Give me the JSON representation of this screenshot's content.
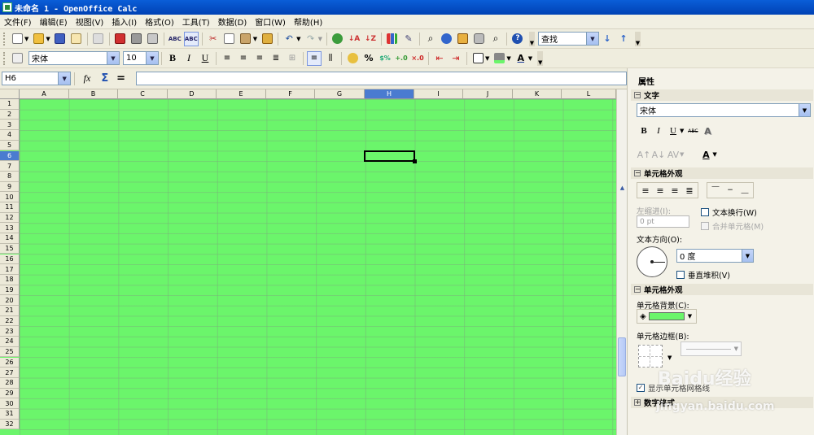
{
  "window": {
    "title": "未命名 1 - OpenOffice Calc"
  },
  "menu": [
    "文件(F)",
    "编辑(E)",
    "视图(V)",
    "插入(I)",
    "格式(O)",
    "工具(T)",
    "数据(D)",
    "窗口(W)",
    "帮助(H)"
  ],
  "toolbar": {
    "find_placeholder": "查找",
    "font_name": "宋体",
    "font_size": "10",
    "bold": "B",
    "italic": "I",
    "underline": "U"
  },
  "formula_bar": {
    "name_box": "H6",
    "function_wizard": "fx",
    "sum": "Σ",
    "equals": "=",
    "formula_value": ""
  },
  "sheet": {
    "columns": [
      "A",
      "B",
      "C",
      "D",
      "E",
      "F",
      "G",
      "H",
      "I",
      "J",
      "K",
      "L"
    ],
    "selected_column": "H",
    "rows": [
      "1",
      "2",
      "3",
      "4",
      "5",
      "6",
      "7",
      "8",
      "9",
      "10",
      "11",
      "12",
      "13",
      "14",
      "15",
      "16",
      "17",
      "18",
      "19",
      "20",
      "21",
      "22",
      "23",
      "24",
      "25",
      "26",
      "27",
      "28",
      "29",
      "30",
      "31",
      "32"
    ],
    "selected_row": "6",
    "background": "#6bf56b"
  },
  "sidebar": {
    "title": "属性",
    "text_section": "文字",
    "font": "宋体",
    "format_buttons": {
      "bold": "B",
      "italic": "I",
      "underline": "U",
      "strike": "ABC",
      "shadow": "A"
    },
    "cell_appearance_section": "单元格外观",
    "indent_label": "左缩进(I):",
    "indent_value": "0 pt",
    "wrap_text": "文本换行(W)",
    "merge_cells": "合并单元格(M)",
    "text_orientation_label": "文本方向(O):",
    "angle_value": "0 度",
    "vertical_stack": "垂直堆积(V)",
    "cell_appearance_section2": "单元格外观",
    "cell_background_label": "单元格背景(C):",
    "cell_border_label": "单元格边框(B):",
    "show_grid": "显示单元格网格线",
    "number_format_section": "数字格式",
    "accent_color": "#6bf56b"
  },
  "watermark": {
    "brand": "Baidu经验",
    "url": "jingyan.baidu.com"
  }
}
